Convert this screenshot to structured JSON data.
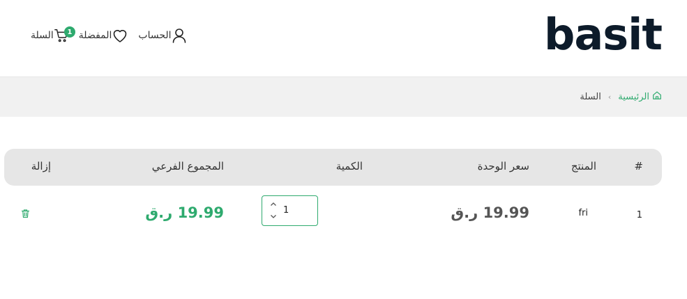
{
  "brand": {
    "logo_text": "basit"
  },
  "nav": {
    "account_label": "الحساب",
    "wishlist_label": "المفضلة",
    "cart_label": "السلة",
    "cart_count": "1"
  },
  "breadcrumb": {
    "home_label": "الرئيسية",
    "separator": "›",
    "current_label": "السلة"
  },
  "cart_table": {
    "headers": {
      "num": "#",
      "product": "المنتج",
      "unit_price": "سعر الوحدة",
      "quantity": "الكمية",
      "subtotal": "المجموع الفرعي",
      "remove": "إزالة"
    },
    "rows": [
      {
        "num": "1",
        "product": "fri",
        "unit_price": "19.99 ر.ق",
        "quantity": "1",
        "subtotal": "19.99 ر.ق"
      }
    ]
  },
  "colors": {
    "accent": "#2eaa6e",
    "logo": "#0d1b2a",
    "header_bg": "#e6e6e6",
    "breadcrumb_bg": "#f1f1f1"
  },
  "icons": {
    "account": "user-icon",
    "wishlist": "heart-icon",
    "cart": "cart-icon",
    "home": "home-icon",
    "remove": "trash-icon",
    "increment": "chevron-up-icon",
    "decrement": "chevron-down-icon"
  }
}
